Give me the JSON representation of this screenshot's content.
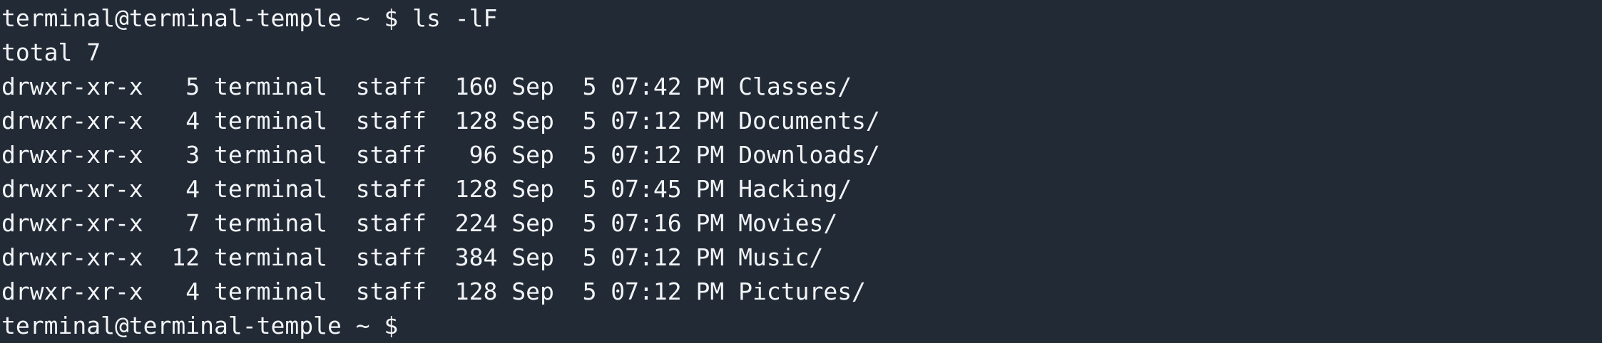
{
  "terminal": {
    "command_prompt": "terminal@terminal-temple ~ $ ls -lF",
    "total_line": "total 7",
    "entries": [
      "drwxr-xr-x   5 terminal  staff  160 Sep  5 07:42 PM Classes/",
      "drwxr-xr-x   4 terminal  staff  128 Sep  5 07:12 PM Documents/",
      "drwxr-xr-x   3 terminal  staff   96 Sep  5 07:12 PM Downloads/",
      "drwxr-xr-x   4 terminal  staff  128 Sep  5 07:45 PM Hacking/",
      "drwxr-xr-x   7 terminal  staff  224 Sep  5 07:16 PM Movies/",
      "drwxr-xr-x  12 terminal  staff  384 Sep  5 07:12 PM Music/",
      "drwxr-xr-x   4 terminal  staff  128 Sep  5 07:12 PM Pictures/"
    ],
    "current_prompt": "terminal@terminal-temple ~ $"
  },
  "colors": {
    "background": "#222a35",
    "foreground": "#f2f4f7"
  }
}
